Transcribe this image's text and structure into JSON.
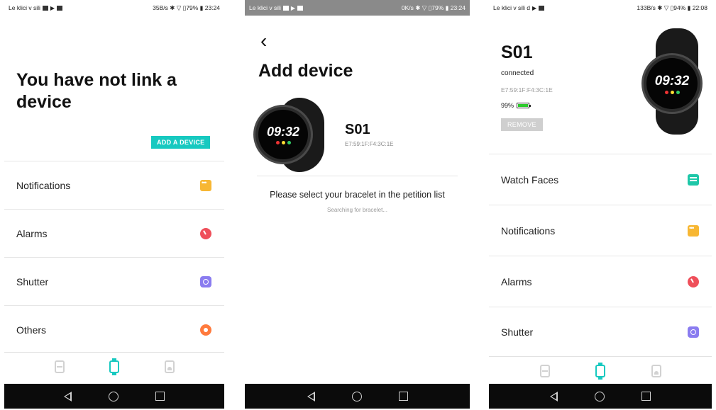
{
  "screen1": {
    "status": {
      "left": "Le klici v sili",
      "right": "35B/s ✱ ▽ ▯79% ▮ 23:24"
    },
    "title": "You have not link a device",
    "add_button": "ADD A DEVICE",
    "items": [
      {
        "label": "Notifications",
        "icon": "notification-icon"
      },
      {
        "label": "Alarms",
        "icon": "alarm-icon"
      },
      {
        "label": "Shutter",
        "icon": "camera-icon"
      },
      {
        "label": "Others",
        "icon": "settings-icon"
      }
    ]
  },
  "screen2": {
    "status": {
      "left": "Le klici v sili",
      "right": "0K/s ✱ ▽ ▯79% ▮ 23:24"
    },
    "back": "‹",
    "title": "Add device",
    "device": {
      "name": "S01",
      "mac": "E7:59:1F:F4:3C:1E",
      "time": "09:32"
    },
    "prompt": "Please select your bracelet in the petition list",
    "searching": "Searching for bracelet..."
  },
  "screen3": {
    "status": {
      "left": "Le klici v sili d",
      "right": "133B/s ✱ ▽ ▯94% ▮ 22:08"
    },
    "device": {
      "name": "S01",
      "state": "connected",
      "mac": "E7:59:1F:F4:3C:1E",
      "battery": "99%",
      "battery_level": 0.99,
      "time": "09:32"
    },
    "remove_button": "REMOVE",
    "items": [
      {
        "label": "Watch Faces",
        "icon": "watch-face-icon"
      },
      {
        "label": "Notifications",
        "icon": "notification-icon"
      },
      {
        "label": "Alarms",
        "icon": "alarm-icon"
      },
      {
        "label": "Shutter",
        "icon": "camera-icon"
      }
    ]
  },
  "colors": {
    "accent": "#17c9c0",
    "notification": "#f7b733",
    "alarm": "#ef4f5a",
    "shutter": "#8a7cf0",
    "others": "#ff7a3d",
    "battery": "#2ecc2e"
  }
}
